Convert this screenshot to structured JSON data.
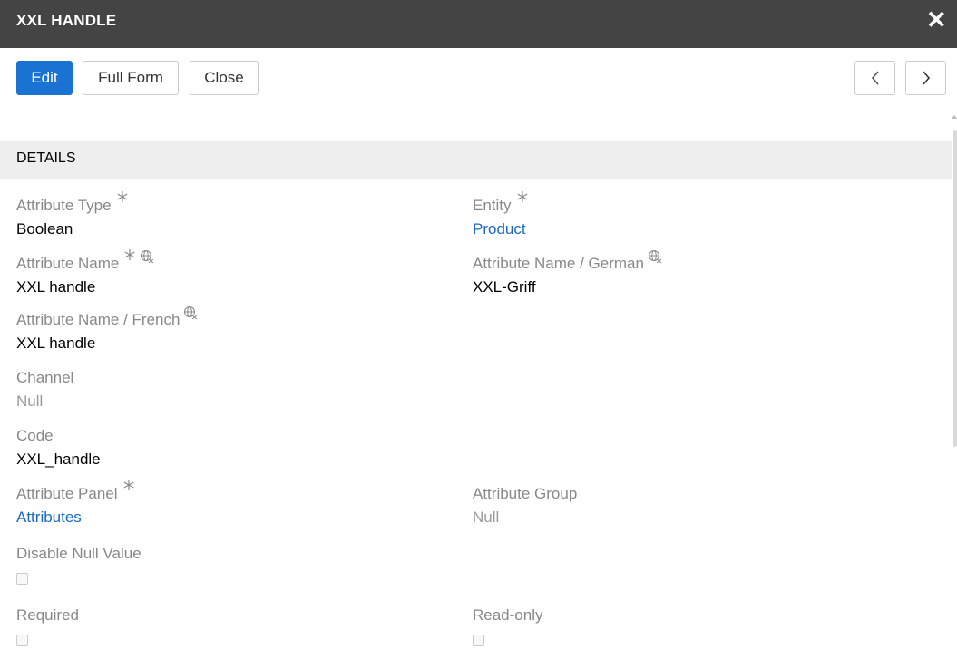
{
  "header": {
    "title": "XXL HANDLE",
    "close_icon": "close-icon"
  },
  "toolbar": {
    "edit_label": "Edit",
    "full_form_label": "Full Form",
    "close_label": "Close",
    "prev_icon": "chevron-left-icon",
    "next_icon": "chevron-right-icon"
  },
  "panel": {
    "heading": "DETAILS"
  },
  "fields": {
    "attribute_type": {
      "label": "Attribute Type",
      "value": "Boolean",
      "required": true
    },
    "entity": {
      "label": "Entity",
      "value": "Product",
      "required": true
    },
    "attribute_name": {
      "label": "Attribute Name",
      "value": "XXL handle",
      "required": true
    },
    "attribute_name_german": {
      "label": "Attribute Name / German",
      "value": "XXL-Griff"
    },
    "attribute_name_french": {
      "label": "Attribute Name / French",
      "value": "XXL handle"
    },
    "channel": {
      "label": "Channel",
      "value": "Null"
    },
    "code": {
      "label": "Code",
      "value": "XXL_handle"
    },
    "attribute_panel": {
      "label": "Attribute Panel",
      "value": "Attributes",
      "required": true
    },
    "attribute_group": {
      "label": "Attribute Group",
      "value": "Null"
    },
    "disable_null_value": {
      "label": "Disable Null Value",
      "checked": false
    },
    "required": {
      "label": "Required",
      "checked": false
    },
    "read_only": {
      "label": "Read-only",
      "checked": false
    }
  },
  "colors": {
    "header_bg": "#444444",
    "primary": "#1a73d3",
    "link": "#1a68c4",
    "muted_label": "#888888"
  }
}
